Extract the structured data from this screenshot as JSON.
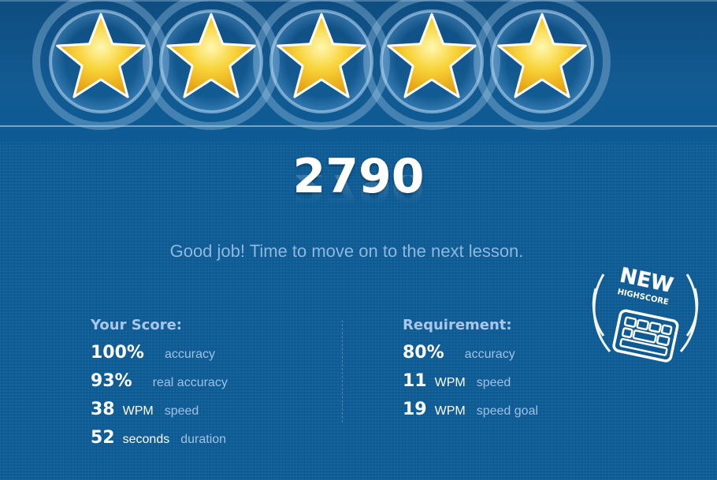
{
  "rating": {
    "stars": 5,
    "max_stars": 5,
    "star_icon": "star-icon"
  },
  "score": "2790",
  "message": "Good job! Time to move on to the next lesson.",
  "your_score": {
    "heading": "Your Score:",
    "rows": [
      {
        "value": "100%",
        "unit": "",
        "label": "accuracy"
      },
      {
        "value": "93%",
        "unit": "",
        "label": "real accuracy"
      },
      {
        "value": "38",
        "unit": "WPM",
        "label": "speed"
      },
      {
        "value": "52",
        "unit": "seconds",
        "label": "duration"
      }
    ]
  },
  "requirement": {
    "heading": "Requirement:",
    "rows": [
      {
        "value": "80%",
        "unit": "",
        "label": "accuracy"
      },
      {
        "value": "11",
        "unit": "WPM",
        "label": "speed"
      },
      {
        "value": "19",
        "unit": "WPM",
        "label": "speed goal"
      }
    ]
  },
  "badge": {
    "title": "NEW",
    "subtitle": "HIGHSCORE",
    "icon": "keyboard-icon"
  },
  "colors": {
    "background": "#0d5a94",
    "star": "#f6c21a",
    "accent_text": "#8db8de"
  }
}
